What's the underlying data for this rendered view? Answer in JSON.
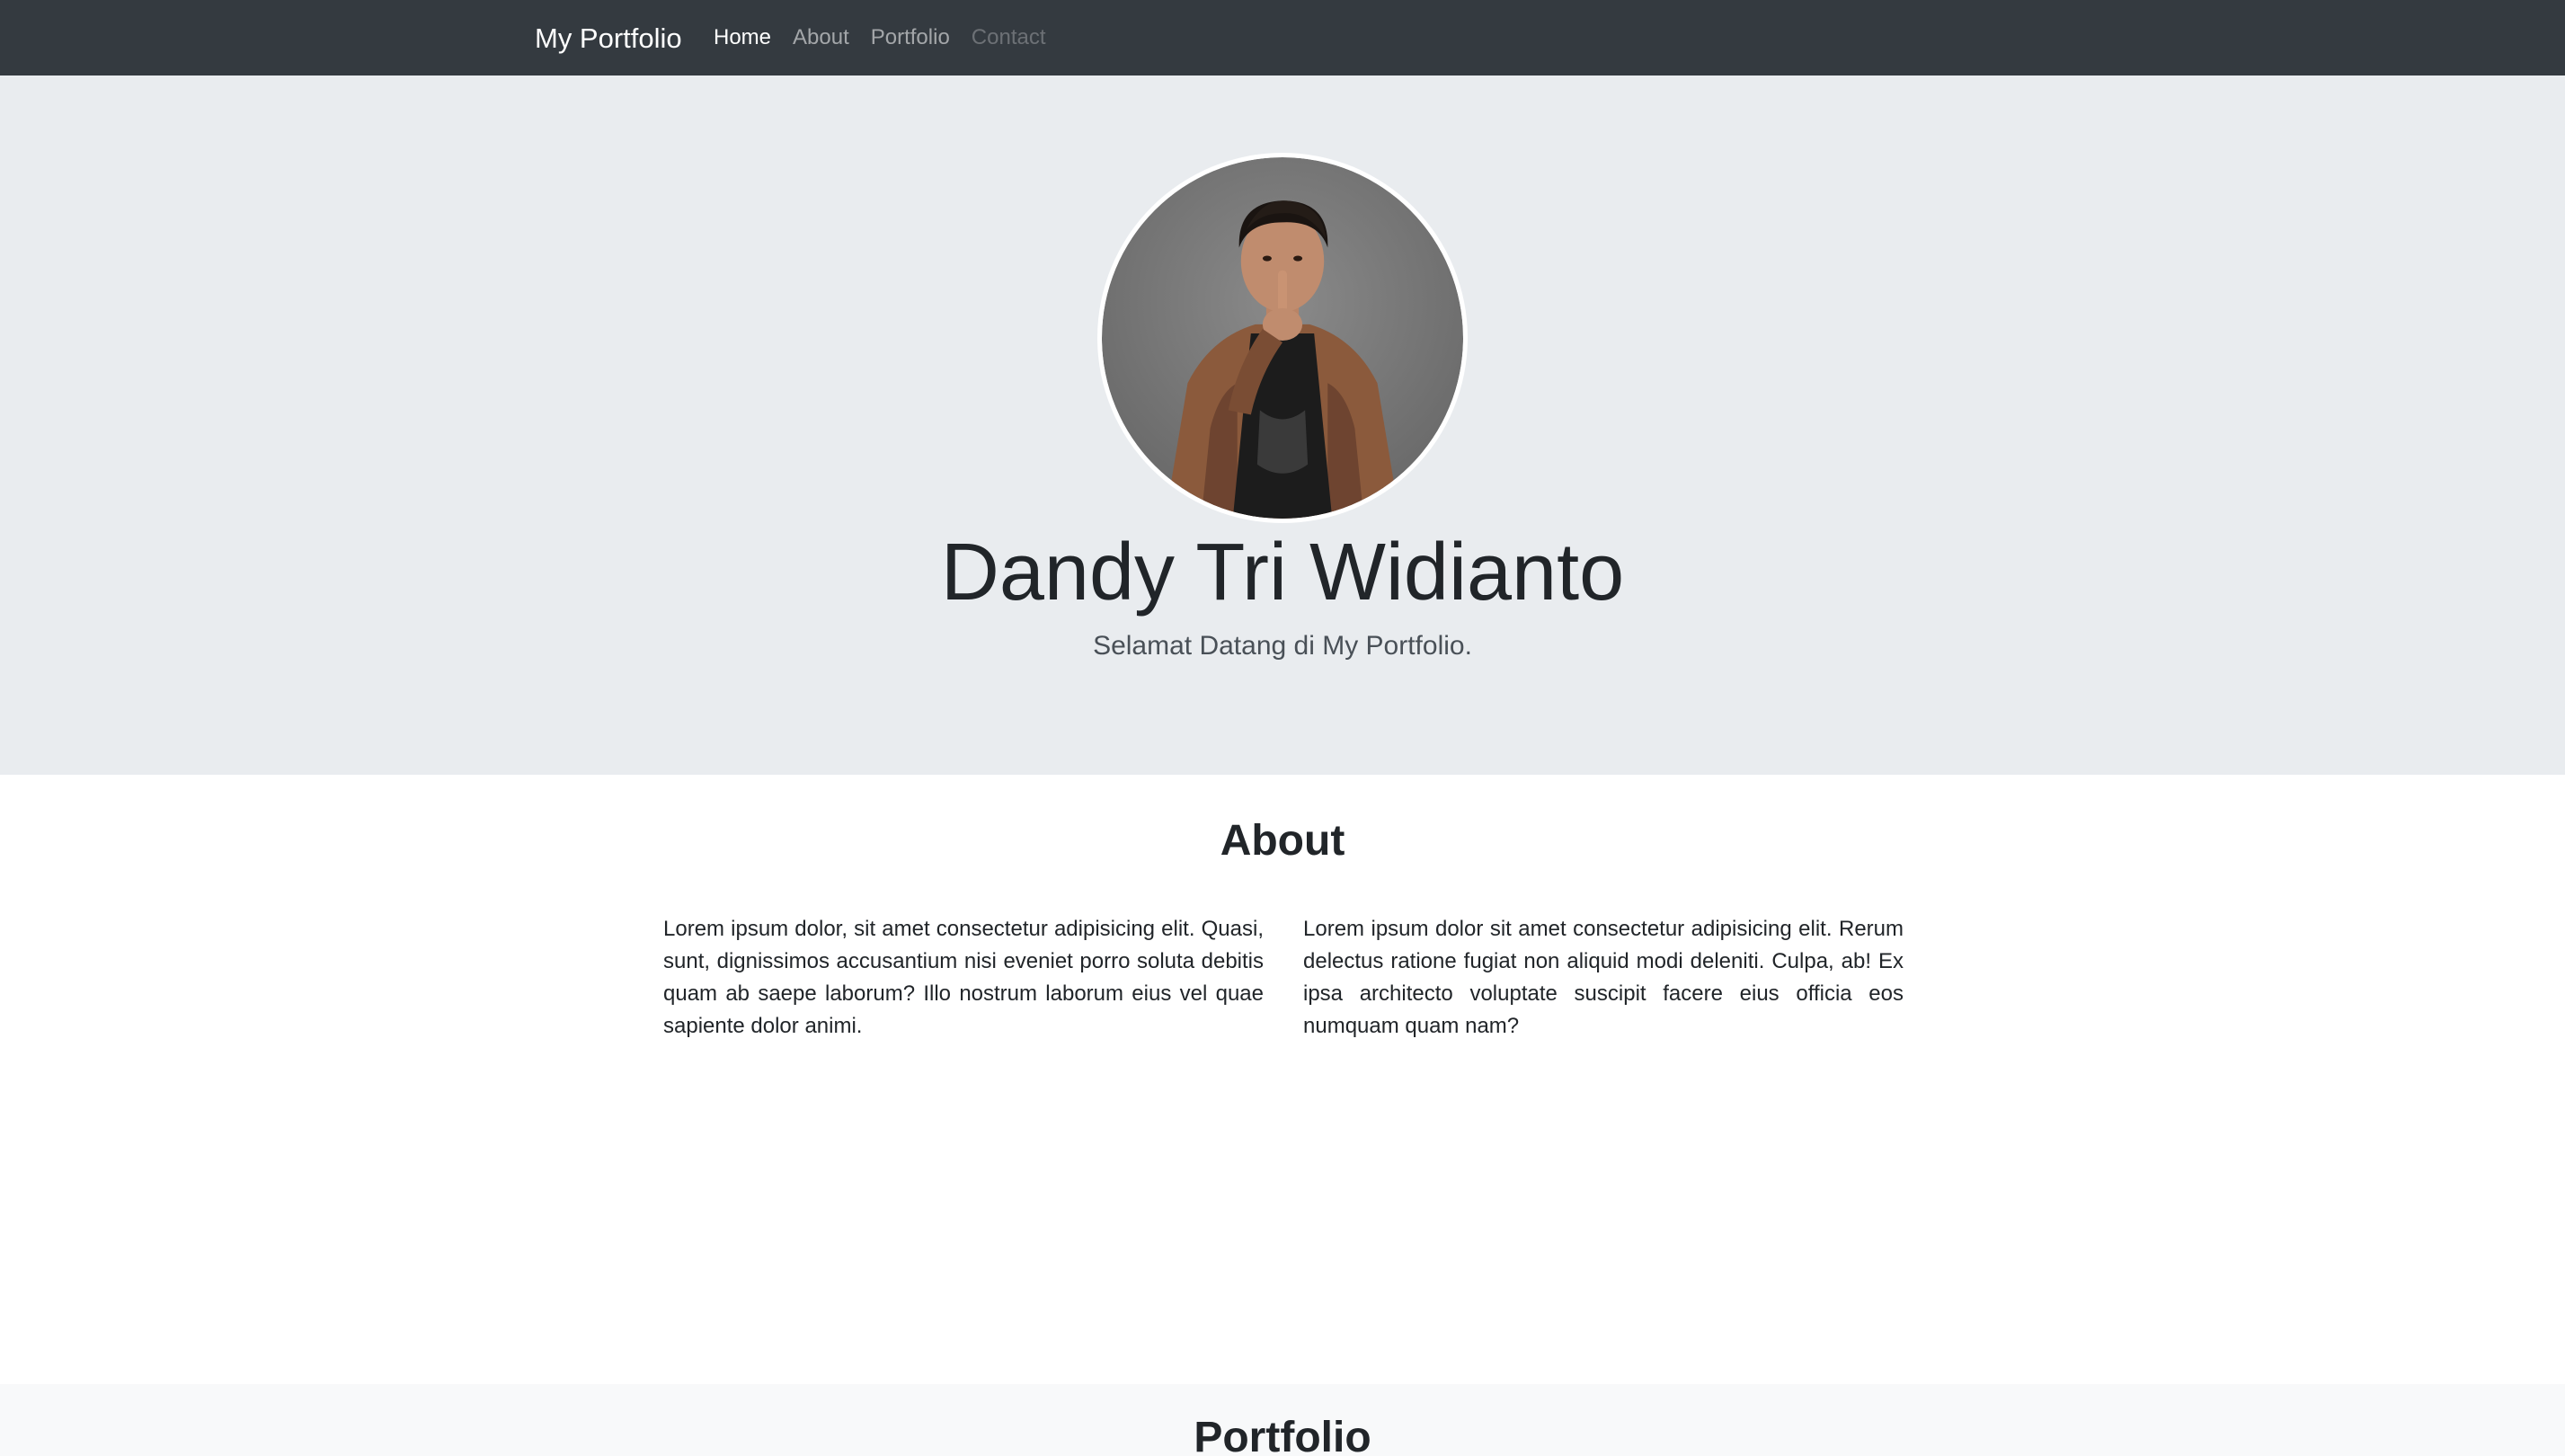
{
  "navbar": {
    "brand": "My Portfolio",
    "links": [
      {
        "label": "Home",
        "state": "active"
      },
      {
        "label": "About",
        "state": "normal"
      },
      {
        "label": "Portfolio",
        "state": "normal"
      },
      {
        "label": "Contact",
        "state": "disabled"
      }
    ]
  },
  "hero": {
    "avatar_icon": "profile-photo",
    "name": "Dandy Tri Widianto",
    "tagline": "Selamat Datang di My Portfolio."
  },
  "about": {
    "title": "About",
    "paragraph_left": "Lorem ipsum dolor, sit amet consectetur adipisicing elit. Quasi, sunt, dignissimos accusantium nisi eveniet porro soluta debitis quam ab saepe laborum? Illo nostrum laborum eius vel quae sapiente dolor animi.",
    "paragraph_right": "Lorem ipsum dolor sit amet consectetur adipisicing elit. Rerum delectus ratione fugiat non aliquid modi deleniti. Culpa, ab! Ex ipsa architecto voluptate suscipit facere eius officia eos numquam quam nam?"
  },
  "portfolio": {
    "title": "Portfolio"
  },
  "colors": {
    "navbar_bg": "#343a40",
    "hero_bg": "#e9ecef",
    "portfolio_bg": "#f8f9fa",
    "text": "#212529"
  }
}
